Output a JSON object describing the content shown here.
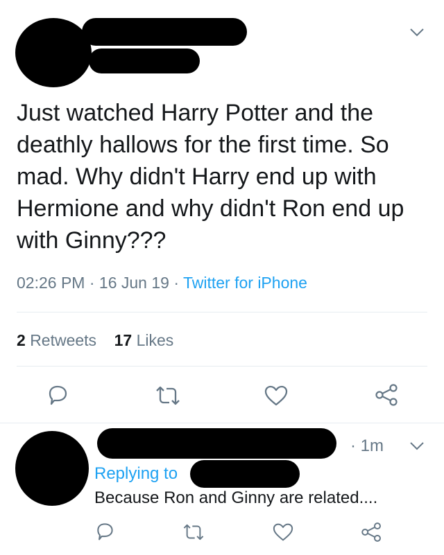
{
  "tweet": {
    "text": "Just watched Harry Potter and the deathly hallows for the first time. So mad. Why didn't Harry end up with Hermione and why didn't Ron end up with Ginny???",
    "time": "02:26 PM",
    "sep1": " · ",
    "date": "16 Jun 19",
    "sep2": " · ",
    "source": "Twitter for iPhone",
    "retweets_count": "2",
    "retweets_label": "Retweets",
    "likes_count": "17",
    "likes_label": "Likes"
  },
  "reply": {
    "time": "· 1m",
    "replying_to": "Replying to",
    "text": "Because Ron and Ginny are related...."
  },
  "icons": {
    "reply": "speech-bubble-icon",
    "retweet": "retweet-icon",
    "like": "heart-icon",
    "share": "share-icon",
    "more": "chevron-down-icon"
  },
  "colors": {
    "text": "#14171a",
    "secondary": "#657786",
    "link": "#1da1f2",
    "divider": "#e6ecf0",
    "redaction": "#000000"
  }
}
